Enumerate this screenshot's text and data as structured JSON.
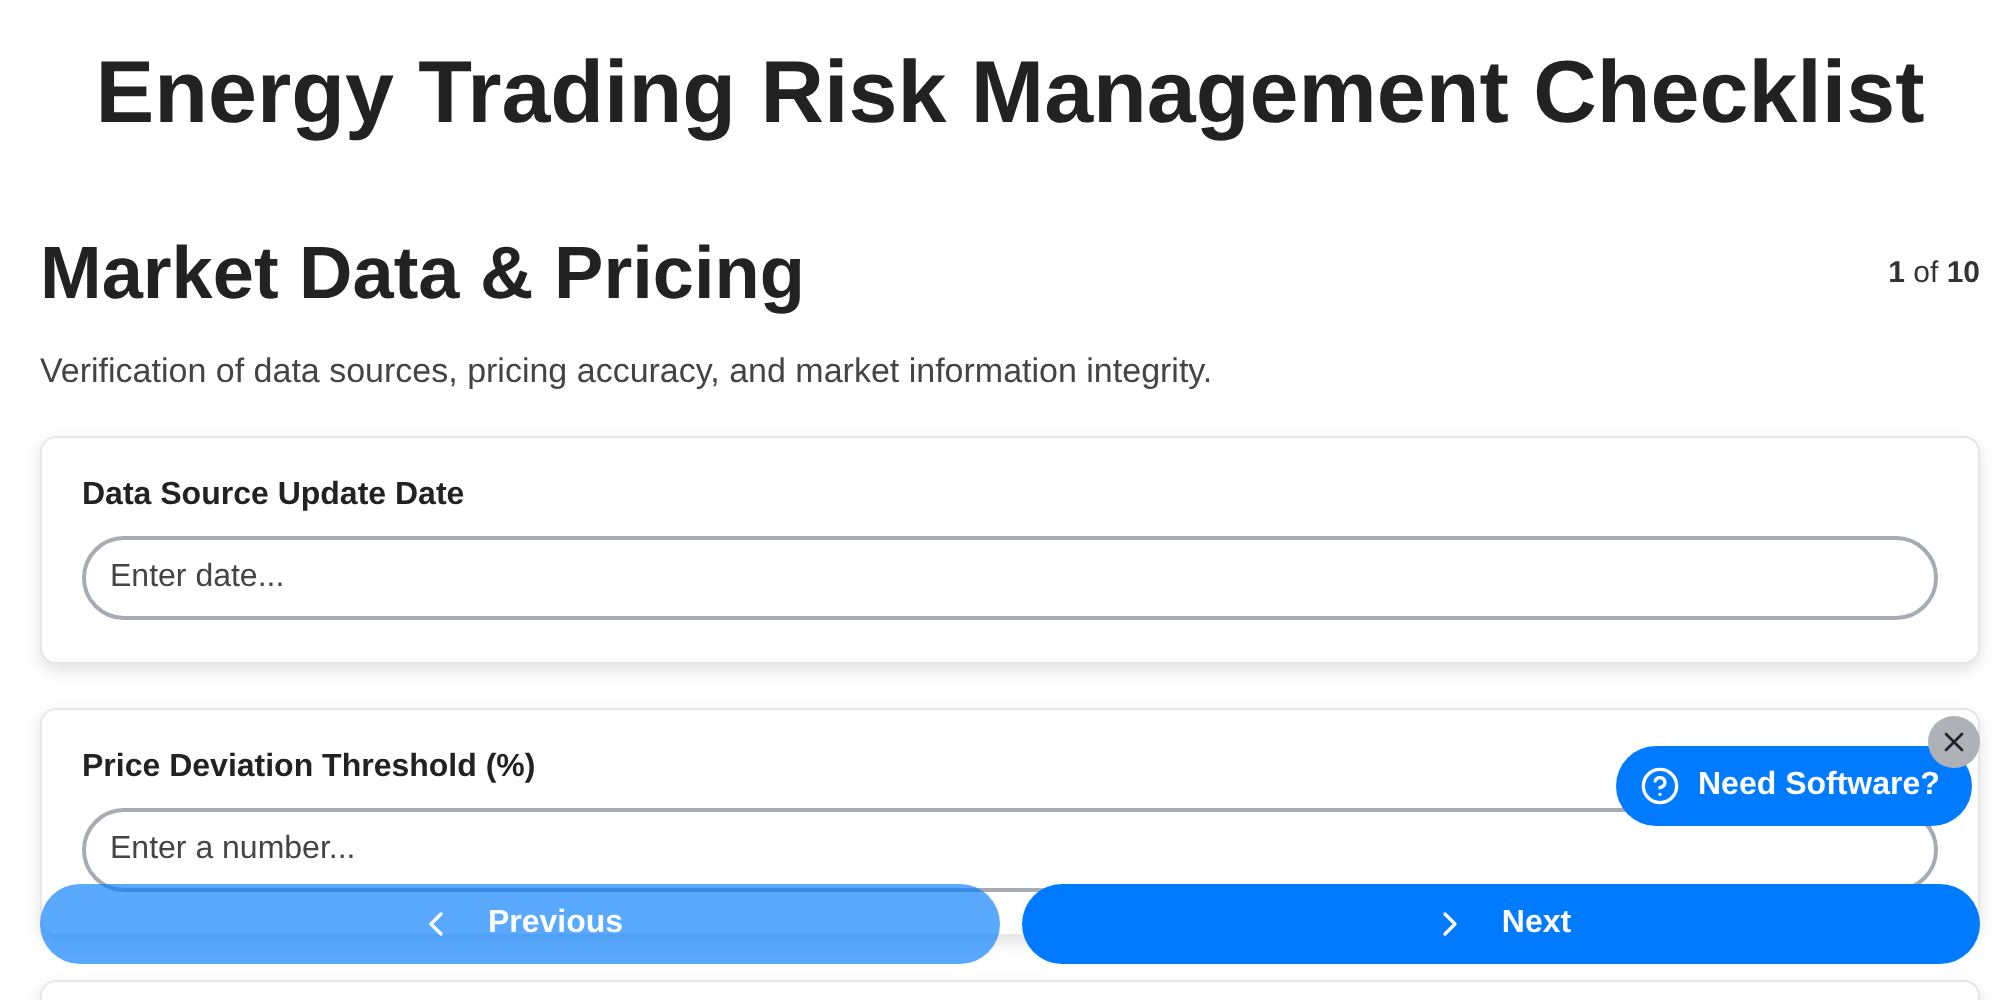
{
  "title": "Energy Trading Risk Management Checklist",
  "section": {
    "title": "Market Data & Pricing",
    "counter": "**1** of **10**",
    "description": "Verification of data sources, pricing accuracy, and market information integrity."
  },
  "questions": [
    {
      "kind": "field",
      "label": "Data Source Update Date",
      "placeholder": "Enter date..."
    },
    {
      "kind": "field",
      "label": "Price Deviation Threshold (%)",
      "placeholder": "Enter a number..."
    },
    {
      "kind": "empty"
    }
  ],
  "nav": [
    {
      "label": "Previous",
      "kind": "back",
      "disabled": true
    },
    {
      "label": "Next",
      "kind": "forward",
      "disabled": false
    }
  ],
  "help": {
    "label": "Need Software?"
  }
}
